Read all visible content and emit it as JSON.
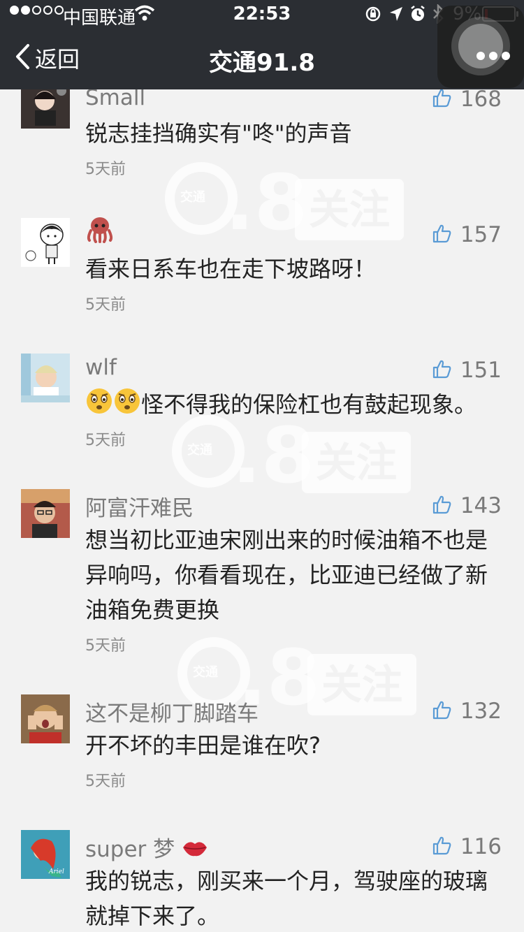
{
  "status_bar": {
    "carrier": "中国联通",
    "time": "22:53",
    "battery_percent_label": "9%",
    "battery_level": 0.09,
    "signal_bars_filled": 2,
    "signal_bars_total": 5
  },
  "nav": {
    "back_label": "返回",
    "title": "交通91.8"
  },
  "watermark": {
    "badge_text": "交通",
    "number": "91.8",
    "follow_text": "关注"
  },
  "comments": [
    {
      "username": "Small",
      "likes": "168",
      "text": "锐志挂挡确实有\"咚\"的声音",
      "time": "5天前",
      "avatar": "dark-cartoon-avatar"
    },
    {
      "username": "",
      "username_icon": "octopus-emoji",
      "likes": "157",
      "text": "看来日系车也在走下坡路呀！",
      "time": "5天前",
      "avatar": "cartoon-boy-avatar"
    },
    {
      "username": "wlf",
      "likes": "151",
      "text_prefix_icons": [
        "worried-face-emoji",
        "worried-face-emoji"
      ],
      "text": "怪不得我的保险杠也有鼓起现象。",
      "time": "5天前",
      "avatar": "baby-photo-avatar"
    },
    {
      "username": "阿富汗难民",
      "likes": "143",
      "text": "想当初比亚迪宋刚出来的时候油箱不也是异响吗，你看看现在，比亚迪已经做了新油箱免费更换",
      "time": "5天前",
      "avatar": "man-glasses-photo-avatar"
    },
    {
      "username": "这不是柳丁脚踏车",
      "likes": "132",
      "text": "开不坏的丰田是谁在吹?",
      "time": "5天前",
      "avatar": "man-hands-face-photo-avatar"
    },
    {
      "username": "super  梦",
      "username_icon": "kiss-lips-emoji",
      "likes": "116",
      "text": "我的锐志，刚买来一个月，驾驶座的玻璃就掉下来了。",
      "time": "",
      "avatar": "mermaid-cartoon-avatar"
    }
  ],
  "colors": {
    "header_bg": "#2b2e33",
    "page_bg": "#f2f2f2",
    "meta_text": "#7a7a7a",
    "body_text": "#222222",
    "battery_low": "#e03030"
  }
}
